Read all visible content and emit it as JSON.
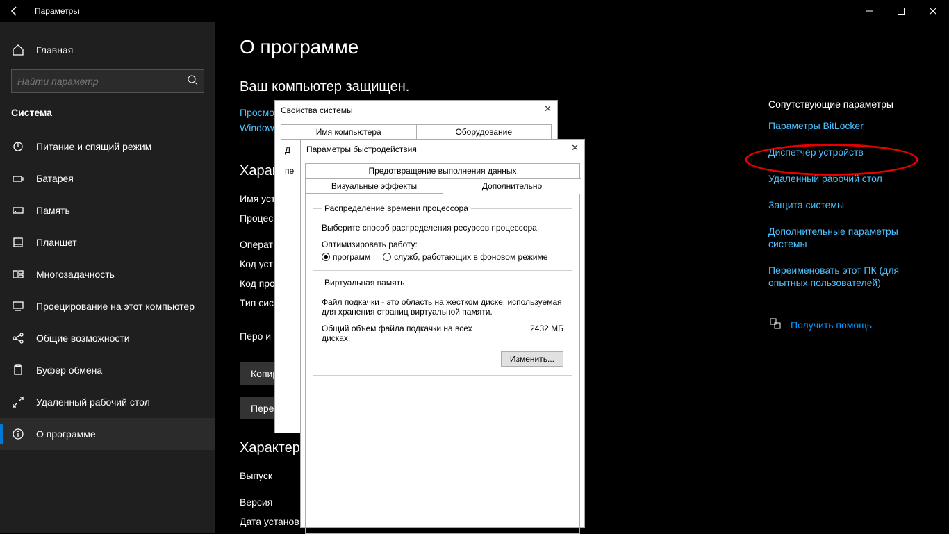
{
  "titlebar": {
    "title": "Параметры"
  },
  "sidebar": {
    "home": "Главная",
    "search_placeholder": "Найти параметр",
    "category": "Система",
    "items": [
      {
        "label": "Питание и спящий режим"
      },
      {
        "label": "Батарея"
      },
      {
        "label": "Память"
      },
      {
        "label": "Планшет"
      },
      {
        "label": "Многозадачность"
      },
      {
        "label": "Проецирование на этот компьютер"
      },
      {
        "label": "Общие возможности"
      },
      {
        "label": "Буфер обмена"
      },
      {
        "label": "Удаленный рабочий стол"
      },
      {
        "label": "О программе"
      }
    ]
  },
  "main": {
    "page_title": "О программе",
    "protected": "Ваш компьютер защищен.",
    "see_link1": "Просмо",
    "see_link2": "Window",
    "device_spec": "Характ",
    "rows": {
      "name": "Имя уст",
      "cpu": "Процес",
      "os": "Операт",
      "devid": "Код уст",
      "prodid": "Код про",
      "systype": "Тип сис"
    },
    "pen": "Перо и",
    "copy_btn": "Копир",
    "rename_btn": "Переи",
    "win_spec": "Характер",
    "edition": "Выпуск",
    "version": "Версия",
    "install": "Дата установ"
  },
  "rail": {
    "heading": "Сопутствующие параметры",
    "links": [
      "Параметры BitLocker",
      "Диспетчер устройств",
      "Удаленный рабочий стол",
      "Защита системы",
      "Дополнительные параметры системы",
      "Переименовать этот ПК (для опытных пользователей)"
    ],
    "help": "Получить помощь"
  },
  "sysprops": {
    "title": "Свойства системы",
    "tabs": [
      "Имя компьютера",
      "Оборудование"
    ],
    "adv_label": "Д",
    "perf_hint": "пе"
  },
  "perf": {
    "title": "Параметры быстродействия",
    "tab_top": "Предотвращение выполнения данных",
    "tab_visual": "Визуальные эффекты",
    "tab_adv": "Дополнительно",
    "sched": {
      "legend": "Распределение времени процессора",
      "desc": "Выберите способ распределения ресурсов процессора.",
      "opt_label": "Оптимизировать работу:",
      "programs": "программ",
      "services": "служб, работающих в фоновом режиме"
    },
    "vm": {
      "legend": "Виртуальная память",
      "desc": "Файл подкачки - это область на жестком диске, используемая для хранения страниц виртуальной памяти.",
      "total_label": "Общий объем файла подкачки на всех дисках:",
      "total_value": "2432 МБ",
      "change": "Изменить..."
    }
  }
}
